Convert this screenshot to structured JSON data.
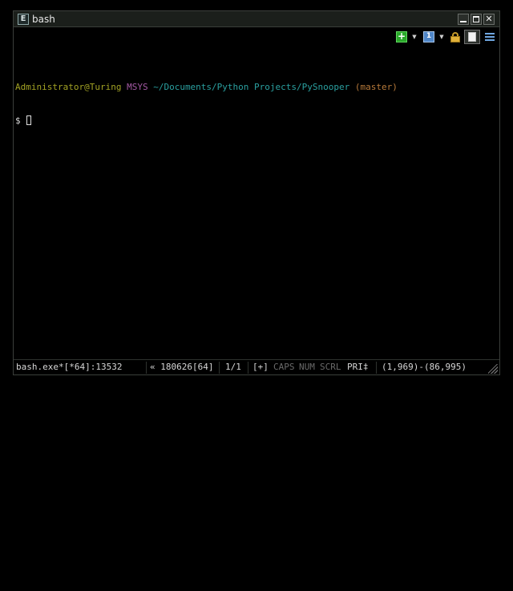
{
  "window": {
    "title": "bash",
    "app_icon_glyph": "E"
  },
  "toolbar": {
    "icons": [
      "new-console-icon",
      "dropdown-arrow-icon",
      "tabs-icon",
      "dropdown-arrow-icon",
      "lock-icon",
      "split-panes-icon",
      "menu-icon"
    ],
    "new_glyph": "+",
    "tabs_glyph": "1",
    "dropdown_glyph": "▼"
  },
  "terminal": {
    "prompt_user": "Administrator@Turing",
    "prompt_system": "MSYS",
    "prompt_path": "~/Documents/Python Projects/PySnooper",
    "prompt_branch": "(master)",
    "prompt_symbol": "$",
    "colors": {
      "user": "#a3a324",
      "system": "#a55aa5",
      "path": "#2aa0a0",
      "branch": "#b87a3a"
    }
  },
  "statusbar": {
    "process": "bash.exe*[*64]:13532",
    "build": "« 180626[64]",
    "tabs": "1/1",
    "plus": "[+]",
    "caps": "CAPS",
    "num": "NUM",
    "scrl": "SCRL",
    "pri": "PRI‡",
    "coords": "(1,969)-(86,995)"
  }
}
